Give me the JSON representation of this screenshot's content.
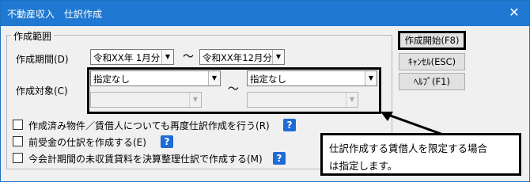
{
  "window": {
    "title": "不動産収入　仕訳作成",
    "close_glyph": "✕"
  },
  "group": {
    "legend": "作成範囲",
    "period_label": "作成期間(D)",
    "period_from": "令和XX年 1月分",
    "period_to": "令和XX年12月分",
    "range_separator": "～",
    "target_label": "作成対象(C)",
    "target_from": "指定なし",
    "target_to": "指定なし",
    "target_from_sub": "",
    "target_to_sub": ""
  },
  "options": [
    {
      "label": "作成済み物件／賃借人についても再度仕訳作成を行う(R)",
      "checked": false
    },
    {
      "label": "前受金の仕訳を作成する(E)",
      "checked": false
    },
    {
      "label": "今会計期間の未収賃貸料を決算整理仕訳で作成する(M)",
      "checked": false
    }
  ],
  "help_glyph": "?",
  "buttons": {
    "start": "作成開始(F8)",
    "cancel": "ｷｬﾝｾﾙ(ESC)",
    "help": "ﾍﾙﾌﾟ(F1)"
  },
  "callout": {
    "line1": "仕訳作成する賃借人を限定する場合",
    "line2": "は指定します。"
  },
  "icons": {
    "dropdown": "chevron-down-icon",
    "help": "help-icon",
    "close": "close-icon"
  },
  "colors": {
    "titlebar": "#1f78d1",
    "help_icon": "#1e6bd6"
  }
}
